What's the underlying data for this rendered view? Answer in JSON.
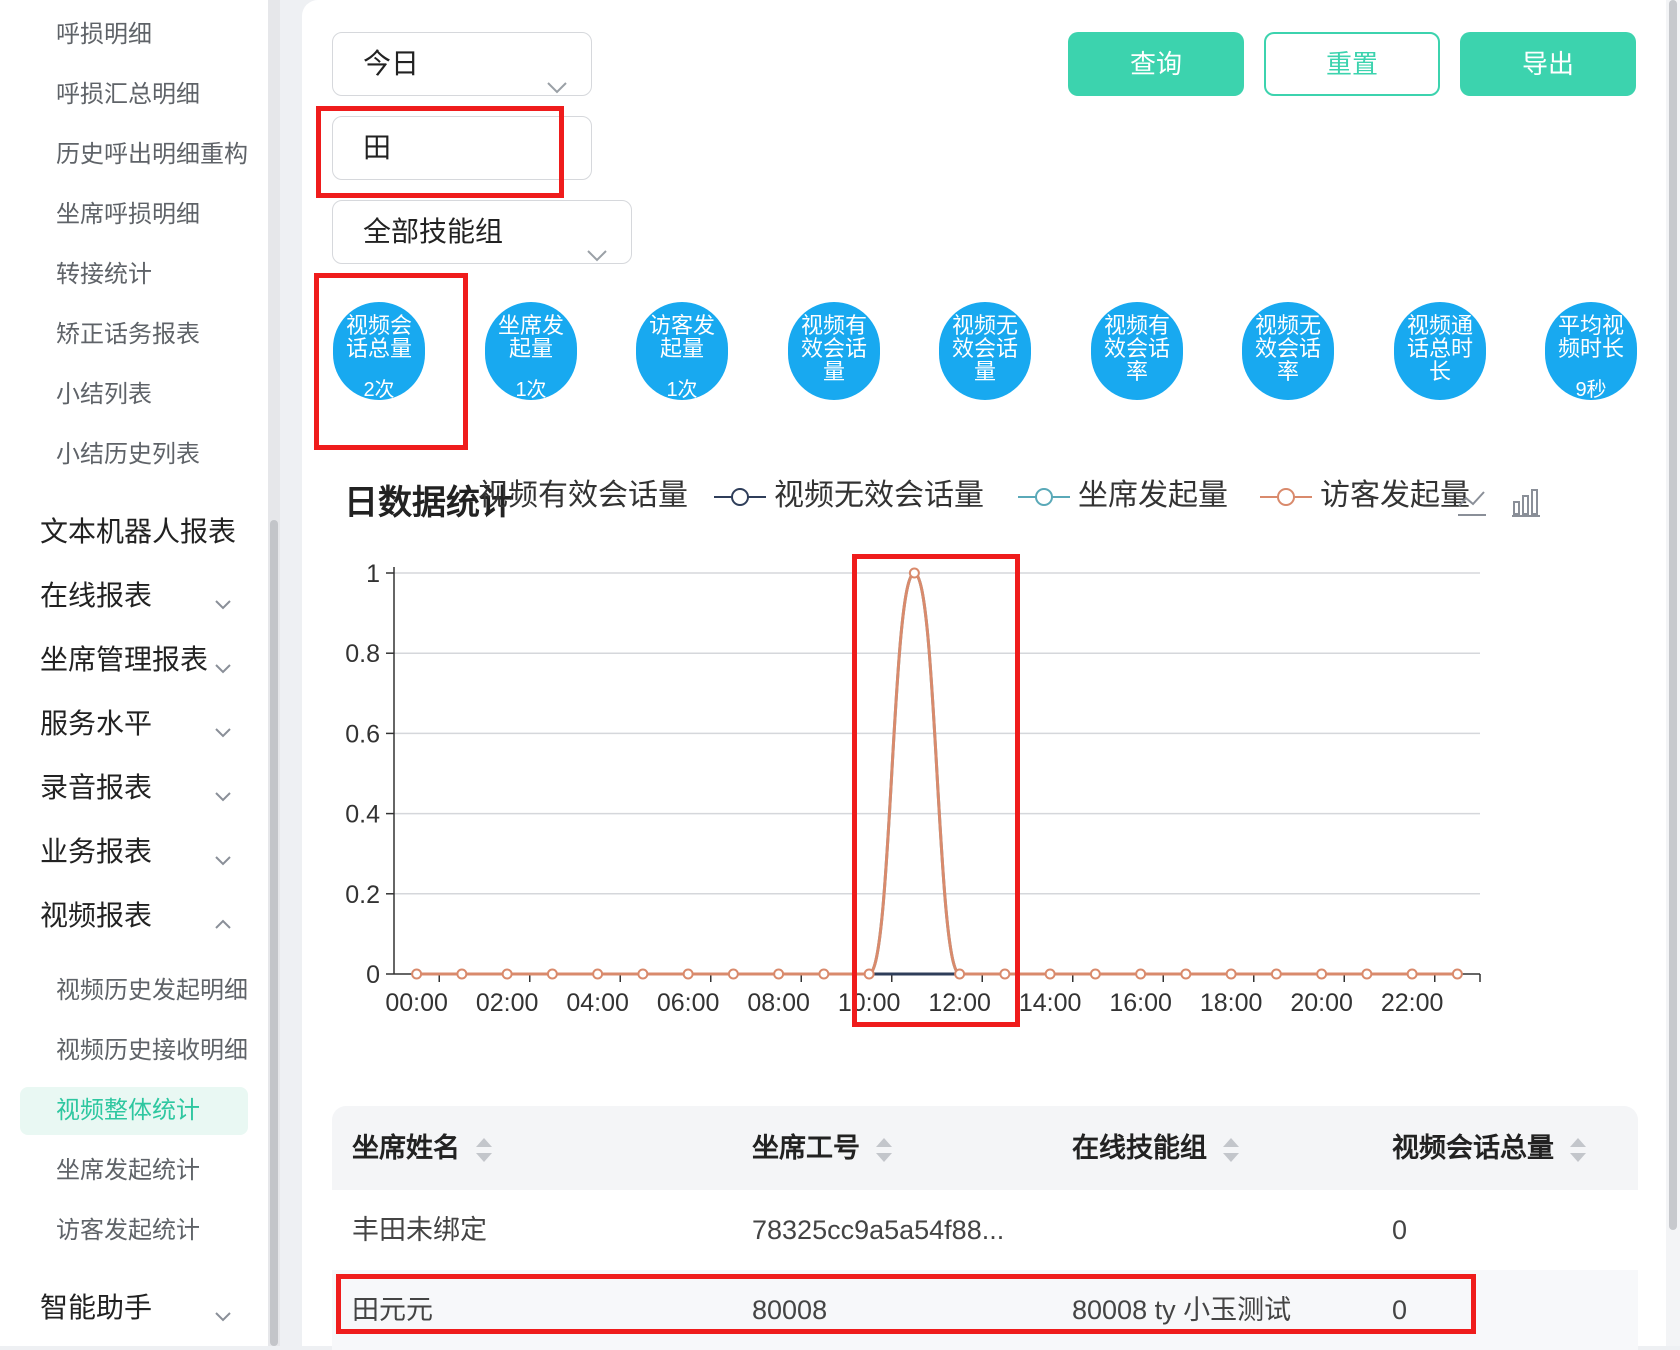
{
  "sidebar": {
    "sub_items_top": [
      "呼损明细",
      "呼损汇总明细",
      "历史呼出明细重构",
      "坐席呼损明细",
      "转接统计",
      "矫正话务报表",
      "小结列表",
      "小结历史列表"
    ],
    "groups": [
      {
        "label": "文本机器人报表",
        "chevron": "none"
      },
      {
        "label": "在线报表",
        "chevron": "down"
      },
      {
        "label": "坐席管理报表",
        "chevron": "down"
      },
      {
        "label": "服务水平",
        "chevron": "down"
      },
      {
        "label": "录音报表",
        "chevron": "down"
      },
      {
        "label": "业务报表",
        "chevron": "down"
      },
      {
        "label": "视频报表",
        "chevron": "up"
      }
    ],
    "video_items": [
      "视频历史发起明细",
      "视频历史接收明细",
      "视频整体统计",
      "坐席发起统计",
      "访客发起统计"
    ],
    "active_item": "视频整体统计",
    "last_group": {
      "label": "智能助手",
      "chevron": "down"
    }
  },
  "filters": {
    "date_range": "今日",
    "name_query": "田",
    "skill_group": "全部技能组"
  },
  "actions": {
    "query": "查询",
    "reset": "重置",
    "export": "导出"
  },
  "metrics": [
    {
      "label": "视频会话总量",
      "value": "2次"
    },
    {
      "label": "坐席发起量",
      "value": "1次"
    },
    {
      "label": "访客发起量",
      "value": "1次"
    },
    {
      "label": "视频有效会话量",
      "value": ""
    },
    {
      "label": "视频无效会话量",
      "value": ""
    },
    {
      "label": "视频有效会话率",
      "value": ""
    },
    {
      "label": "视频无效会话率",
      "value": ""
    },
    {
      "label": "视频通话总时长",
      "value": ""
    },
    {
      "label": "平均视频时长",
      "value": "9秒"
    }
  ],
  "chart_title": "日数据统计",
  "chart_data": {
    "type": "line",
    "title": "日数据统计",
    "x": [
      "00:00",
      "01:00",
      "02:00",
      "03:00",
      "04:00",
      "05:00",
      "06:00",
      "07:00",
      "08:00",
      "09:00",
      "10:00",
      "11:00",
      "12:00",
      "13:00",
      "14:00",
      "15:00",
      "16:00",
      "17:00",
      "18:00",
      "19:00",
      "20:00",
      "21:00",
      "22:00",
      "23:00"
    ],
    "x_tick_labels": [
      "00:00",
      "02:00",
      "04:00",
      "06:00",
      "08:00",
      "10:00",
      "12:00",
      "14:00",
      "16:00",
      "18:00",
      "20:00",
      "22:00"
    ],
    "y_tick_labels": [
      "0",
      "0.2",
      "0.4",
      "0.6",
      "0.8",
      "1"
    ],
    "ylim": [
      0,
      1
    ],
    "smooth": true,
    "grid": true,
    "legend_position": "top",
    "series": [
      {
        "name": "视频有效会话量",
        "color": "#5b8ff9",
        "values": [
          0,
          0,
          0,
          0,
          0,
          0,
          0,
          0,
          0,
          0,
          0,
          0,
          0,
          0,
          0,
          0,
          0,
          0,
          0,
          0,
          0,
          0,
          0,
          0
        ]
      },
      {
        "name": "视频无效会话量",
        "color": "#2f3e5a",
        "values": [
          0,
          0,
          0,
          0,
          0,
          0,
          0,
          0,
          0,
          0,
          0,
          0,
          0,
          0,
          0,
          0,
          0,
          0,
          0,
          0,
          0,
          0,
          0,
          0
        ]
      },
      {
        "name": "坐席发起量",
        "color": "#5aa9b8",
        "values": [
          0,
          0,
          0,
          0,
          0,
          0,
          0,
          0,
          0,
          0,
          0,
          1,
          0,
          0,
          0,
          0,
          0,
          0,
          0,
          0,
          0,
          0,
          0,
          0
        ]
      },
      {
        "name": "访客发起量",
        "color": "#d98a6c",
        "values": [
          0,
          0,
          0,
          0,
          0,
          0,
          0,
          0,
          0,
          0,
          0,
          1,
          0,
          0,
          0,
          0,
          0,
          0,
          0,
          0,
          0,
          0,
          0,
          0
        ]
      }
    ]
  },
  "table": {
    "columns": [
      "坐席姓名",
      "坐席工号",
      "在线技能组",
      "视频会话总量"
    ],
    "rows": [
      [
        "丰田未绑定",
        "78325cc9a5a54f88...",
        "",
        "0"
      ],
      [
        "田元元",
        "80008",
        "80008 ty 小玉测试",
        "0"
      ]
    ]
  },
  "colors": {
    "accent": "#3cd3ae",
    "metric_pill": "#18a9f0",
    "highlight_box": "#ef1c1c"
  }
}
